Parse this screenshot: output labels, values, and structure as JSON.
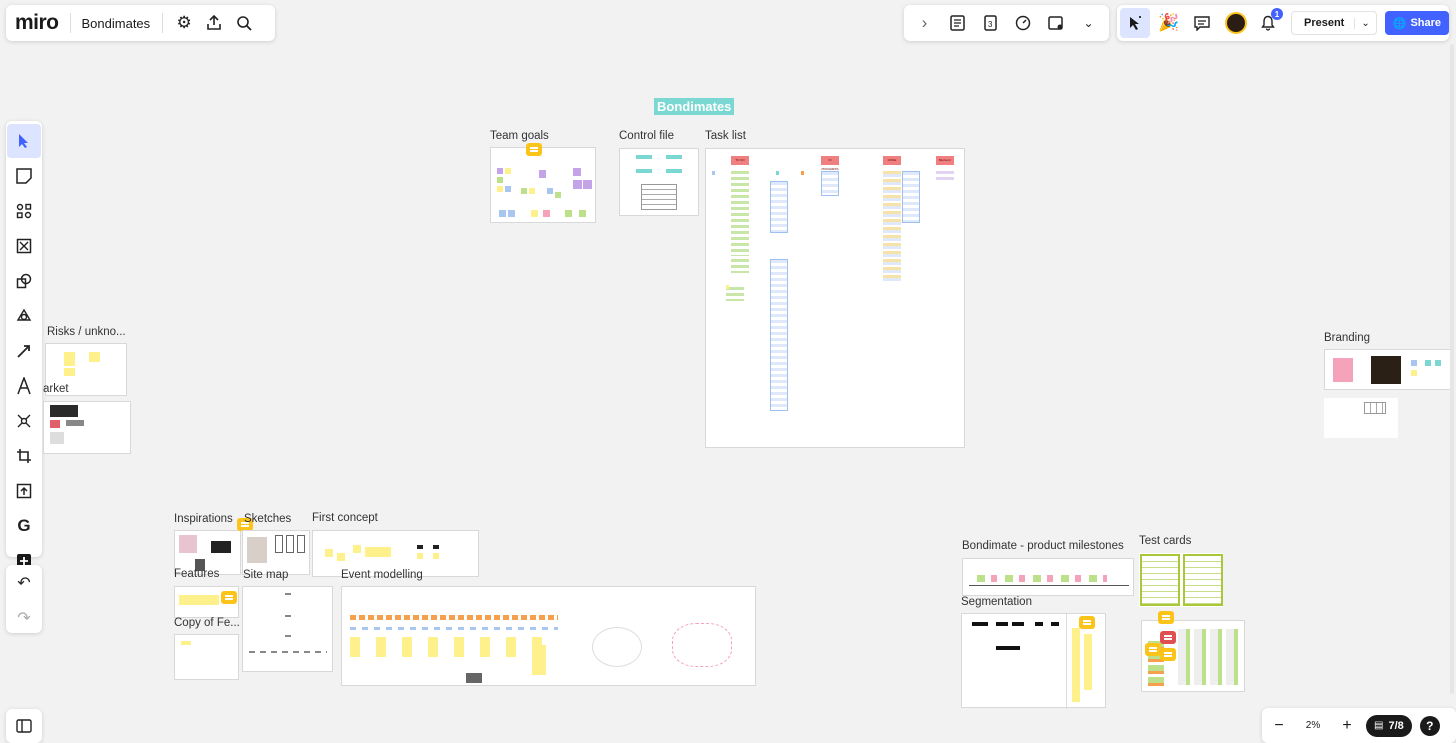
{
  "app": {
    "logo": "miro",
    "board_name": "Bondimates"
  },
  "header_right": {
    "present_label": "Present",
    "share_label": "Share",
    "notification_count": "1"
  },
  "board": {
    "title": "Bondimates",
    "frames": {
      "team_goals": "Team goals",
      "control_file": "Control file",
      "task_list": "Task list",
      "risks": "Risks / unkno...",
      "market": "arket",
      "branding": "Branding",
      "inspirations": "Inspirations",
      "sketches": "Sketches",
      "first_concept": "First concept",
      "features": "Features",
      "site_map": "Site map",
      "event_modelling": "Event modelling",
      "copy_features": "Copy of Fe...",
      "milestones": "Bondimate - product milestones",
      "test_cards": "Test cards",
      "segmentation": "Segmentation"
    },
    "task_columns": [
      "TO DO",
      "IN PROGRESS",
      "DONE",
      "Blocked / Questions"
    ]
  },
  "zoom": {
    "value": "2%",
    "minus": "−",
    "plus": "+"
  },
  "frames_nav": {
    "label": "7/8"
  },
  "help": "?",
  "colors": {
    "accent": "#4262ff",
    "teal_title": "#7ad7d2",
    "sticky_yellow": "#fef08a",
    "comment": "#fcc419"
  },
  "icons": {
    "top_left": [
      "settings-icon",
      "export-icon",
      "search-icon"
    ],
    "top_mid": [
      "chevron-right-icon",
      "notes-icon",
      "calendar-icon",
      "timer-icon",
      "voting-icon",
      "more-icon"
    ],
    "top_right": [
      "cursor-follow-icon",
      "reactions-icon",
      "comments-icon",
      "avatar",
      "bell-icon"
    ],
    "toolbar": [
      "select-icon",
      "sticky-note-icon",
      "templates-icon",
      "frame-tool-icon",
      "shapes-icon",
      "pen-icon",
      "connector-icon",
      "text-icon",
      "mindmap-icon",
      "crop-icon",
      "upload-icon",
      "google-icon",
      "add-icon",
      "undo-icon",
      "redo-icon"
    ]
  }
}
